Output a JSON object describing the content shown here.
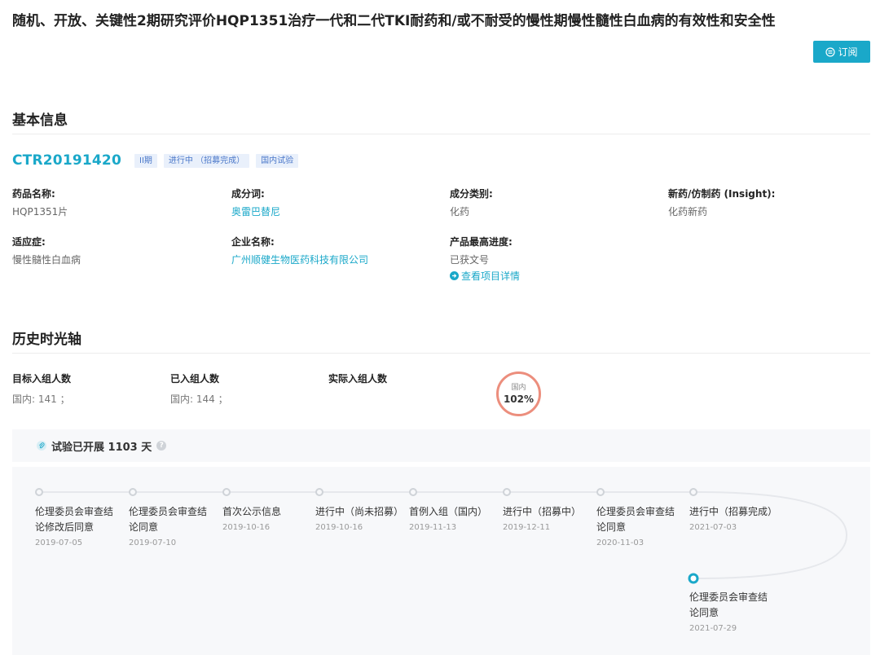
{
  "page": {
    "title": "随机、开放、关键性2期研究评价HQP1351治疗一代和二代TKI耐药和/或不耐受的慢性期慢性髓性白血病的有效性和安全性",
    "subscribe_label": "订阅"
  },
  "basic": {
    "section_title": "基本信息",
    "ctr_id": "CTR20191420",
    "tags": [
      "II期",
      "进行中 （招募完成）",
      "国内试验"
    ],
    "fields": {
      "drug_name": {
        "label": "药品名称:",
        "value": "HQP1351片"
      },
      "ingredient": {
        "label": "成分词:",
        "value": "奥雷巴替尼"
      },
      "category": {
        "label": "成分类别:",
        "value": "化药"
      },
      "new_generic": {
        "label": "新药/仿制药 (Insight):",
        "value": "化药新药"
      },
      "indication": {
        "label": "适应症:",
        "value": "慢性髓性白血病"
      },
      "company": {
        "label": "企业名称:",
        "value": "广州顺健生物医药科技有限公司"
      },
      "top_progress": {
        "label": "产品最高进度:",
        "value": "已获文号"
      }
    },
    "detail_link": "查看项目详情"
  },
  "history": {
    "section_title": "历史时光轴",
    "target_enroll": {
      "label": "目标入组人数",
      "value": "国内: 141 ；"
    },
    "enrolled": {
      "label": "已入组人数",
      "value": "国内: 144 ；"
    },
    "actual_enroll": {
      "label": "实际入组人数"
    },
    "ratio": {
      "label": "国内",
      "value": "102%",
      "percent": 102
    },
    "duration_text": "试验已开展 1103 天",
    "help_glyph": "?",
    "events": [
      {
        "title": "伦理委员会审查结论修改后同意",
        "date": "2019-07-05"
      },
      {
        "title": "伦理委员会审查结论同意",
        "date": "2019-07-10"
      },
      {
        "title": "首次公示信息",
        "date": "2019-10-16"
      },
      {
        "title": "进行中（尚未招募）",
        "date": "2019-10-16"
      },
      {
        "title": "首例入组（国内）",
        "date": "2019-11-13"
      },
      {
        "title": "进行中（招募中）",
        "date": "2019-12-11"
      },
      {
        "title": "伦理委员会审查结论同意",
        "date": "2020-11-03"
      },
      {
        "title": "进行中（招募完成）",
        "date": "2021-07-03"
      },
      {
        "title": "伦理委员会审查结论同意",
        "date": "2021-07-29"
      }
    ]
  },
  "colors": {
    "accent": "#1aa8c9",
    "tag_text": "#4a77c9",
    "tag_bg": "#e9f0fb",
    "ratio_ring": "#ec8e7d",
    "timeline_line": "#e6e8ec"
  }
}
